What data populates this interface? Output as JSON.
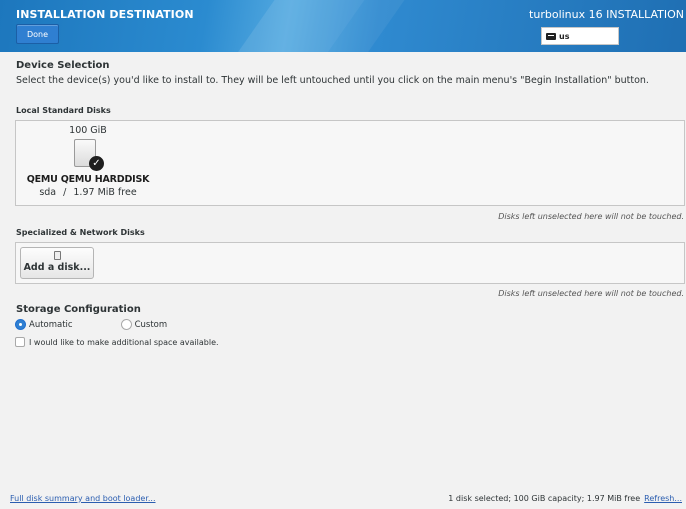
{
  "header": {
    "title": "INSTALLATION DESTINATION",
    "done_label": "Done",
    "product_title": "turbolinux 16 INSTALLATION",
    "keyboard_layout": "us"
  },
  "device_selection": {
    "title": "Device Selection",
    "intro": "Select the device(s) you'd like to install to.  They will be left untouched until you click on the main menu's \"Begin Installation\" button."
  },
  "local_disks": {
    "heading": "Local Standard Disks",
    "disks": [
      {
        "capacity": "100 GiB",
        "name": "QEMU QEMU HARDDISK",
        "device": "sda",
        "separator": "/",
        "free": "1.97 MiB free",
        "selected": true
      }
    ],
    "note": "Disks left unselected here will not be touched."
  },
  "network_disks": {
    "heading": "Specialized & Network Disks",
    "add_label": "Add a disk...",
    "note": "Disks left unselected here will not be touched."
  },
  "storage": {
    "title": "Storage Configuration",
    "automatic_label": "Automatic",
    "custom_label": "Custom",
    "selected": "Automatic",
    "additional_space_label": "I would like to make additional space available.",
    "additional_space_checked": false
  },
  "footer": {
    "summary_link": "Full disk summary and boot loader...",
    "status": "1 disk selected; 100 GiB capacity; 1.97 MiB free",
    "refresh_link": "Refresh..."
  },
  "colors": {
    "header_blue": "#2b8bd0",
    "accent": "#2f7fd1",
    "link": "#2a5db0"
  }
}
